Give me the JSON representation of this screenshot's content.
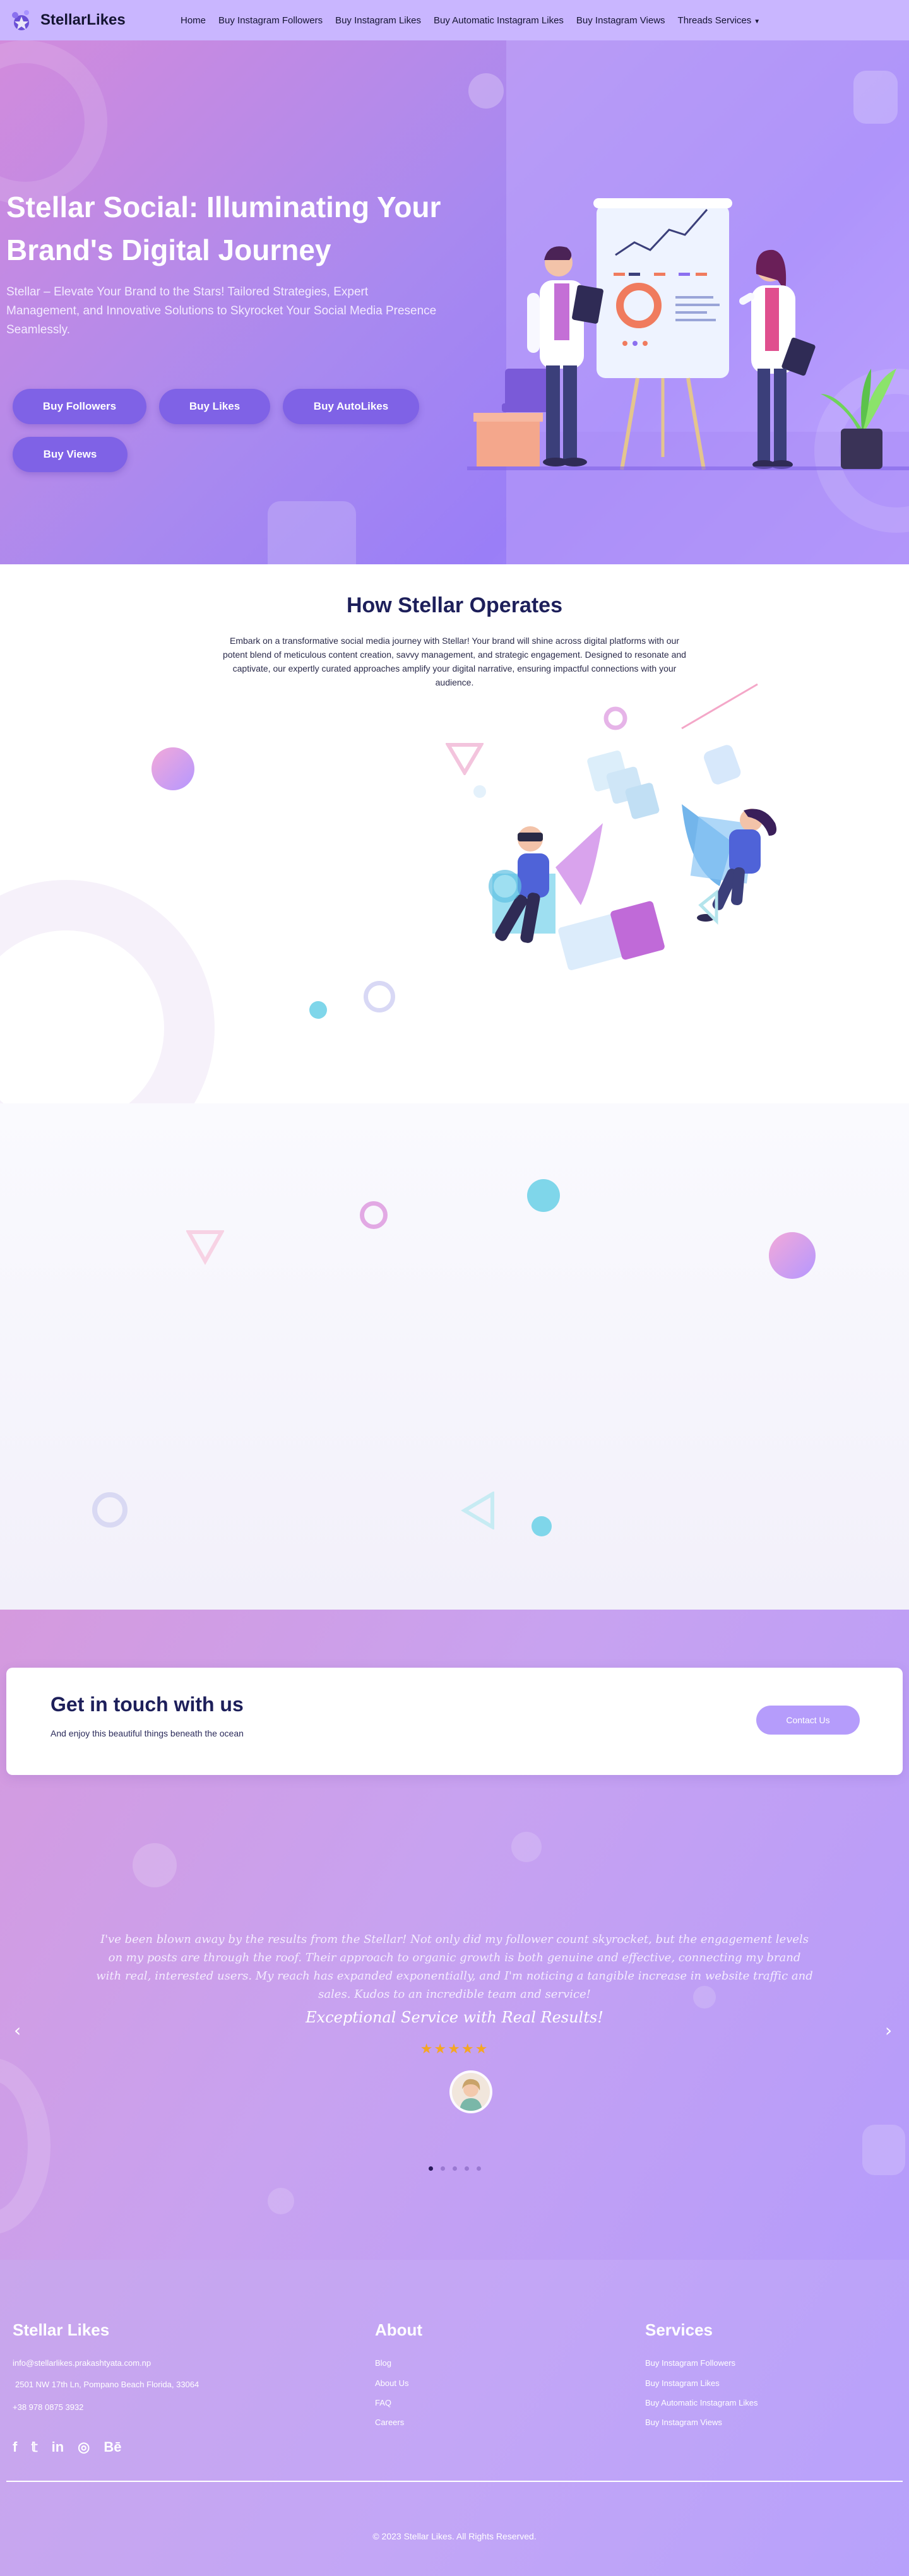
{
  "brand": {
    "name": "StellarLikes"
  },
  "nav": {
    "items": [
      "Home",
      "Buy Instagram Followers",
      "Buy Instagram Likes",
      "Buy Automatic Instagram Likes",
      "Buy Instagram Views",
      "Threads Services"
    ]
  },
  "hero": {
    "title": "Stellar Social: Illuminating Your Brand's Digital Journey",
    "subtitle": "Stellar – Elevate Your Brand to the Stars! Tailored Strategies, Expert Management, and Innovative Solutions to Skyrocket Your Social Media Presence Seamlessly.",
    "buttons": [
      "Buy Followers",
      "Buy Likes",
      "Buy AutoLikes",
      "Buy Views"
    ]
  },
  "how": {
    "title": "How Stellar Operates",
    "body": "Embark on a transformative social media journey with Stellar! Your brand will shine across digital platforms with our potent blend of meticulous content creation, savvy management, and strategic engagement. Designed to resonate and captivate, our expertly curated approaches amplify your digital narrative, ensuring impactful connections with your audience."
  },
  "contact": {
    "title": "Get in touch with us",
    "subtitle": "And enjoy this beautiful things beneath the ocean",
    "button": "Contact Us"
  },
  "testimonial": {
    "quote": "I've been blown away by the results from the Stellar! Not only did my follower count skyrocket, but the engagement levels on my posts are through the roof. Their approach to organic growth is both genuine and effective, connecting my brand with real, interested users. My reach has expanded exponentially, and I'm noticing a tangible increase in website traffic and sales. Kudos to an incredible team and service!",
    "title": "Exceptional Service with Real Results!",
    "stars": "★★★★★",
    "rating": 5,
    "prev_glyph": "‹",
    "next_glyph": "›",
    "slide_count": 5,
    "active_slide": 1
  },
  "footer": {
    "brand_heading": "Stellar Likes",
    "email": "info@stellarlikes.prakashtyata.com.np",
    "address": "2501 NW 17th Ln, Pompano Beach Florida, 33064",
    "phone": "+38 978 0875 3932",
    "social_icons": [
      "facebook-icon",
      "twitter-icon",
      "linkedin-icon",
      "instagram-icon",
      "behance-icon"
    ],
    "social_glyphs": [
      "f",
      "𝕥",
      "in",
      "◎",
      "Bē"
    ],
    "about_heading": "About",
    "about_links": [
      "Blog",
      "About Us",
      "FAQ",
      "Careers"
    ],
    "services_heading": "Services",
    "services_links": [
      "Buy Instagram Followers",
      "Buy Instagram Likes",
      "Buy Automatic Instagram Likes",
      "Buy Instagram Views"
    ],
    "copyright": "© 2023 Stellar Likes. All Rights Reserved."
  },
  "colors": {
    "nav_bg": "#c9b6ff",
    "accent": "#7f62e6",
    "heading_dark": "#1d1f5a",
    "star": "#f5a623"
  }
}
